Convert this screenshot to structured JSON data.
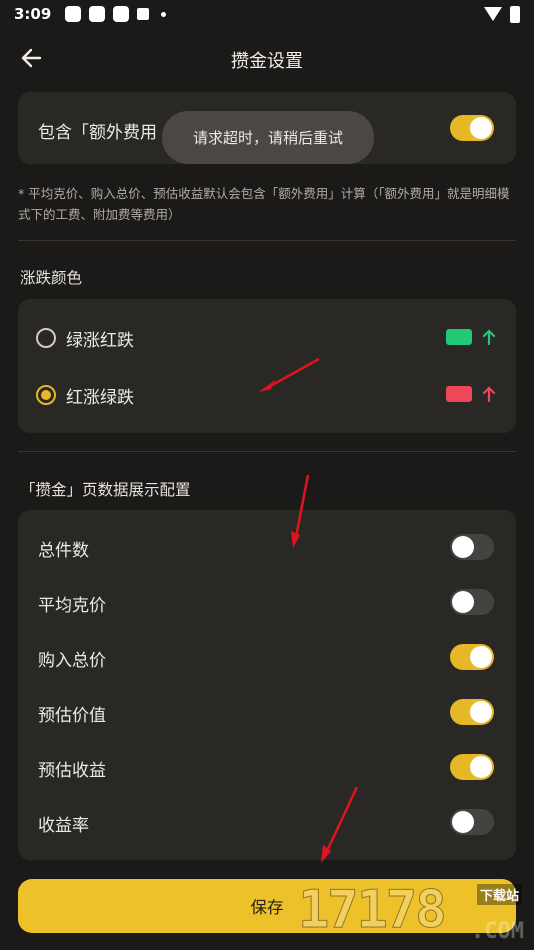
{
  "status_bar": {
    "time": "3:09"
  },
  "header": {
    "title": "攒金设置"
  },
  "extra_fee": {
    "label": "包含「额外费用",
    "toggle_on": true,
    "note": "* 平均克价、购入总价、预估收益默认会包含「额外费用」计算（「额外费用」就是明细模式下的工费、附加费等费用）"
  },
  "toast": {
    "text": "请求超时，请稍后重试"
  },
  "color_section": {
    "title": "涨跌颜色",
    "options": [
      {
        "label": "绿涨红跌",
        "checked": false,
        "swatch_color": "#23c778"
      },
      {
        "label": "红涨绿跌",
        "checked": true,
        "swatch_color": "#f0465a"
      }
    ]
  },
  "display_section": {
    "title": "「攒金」页数据展示配置",
    "items": [
      {
        "label": "总件数",
        "on": false
      },
      {
        "label": "平均克价",
        "on": false
      },
      {
        "label": "购入总价",
        "on": true
      },
      {
        "label": "预估价值",
        "on": true
      },
      {
        "label": "预估收益",
        "on": true
      },
      {
        "label": "收益率",
        "on": false
      }
    ]
  },
  "save_button": {
    "label": "保存"
  },
  "colors": {
    "accent": "#e6b727",
    "background": "#1b1a19",
    "card": "#2a2825"
  },
  "watermark": {
    "digits": "17178",
    "site": "下载站",
    "suffix": ".COM"
  }
}
